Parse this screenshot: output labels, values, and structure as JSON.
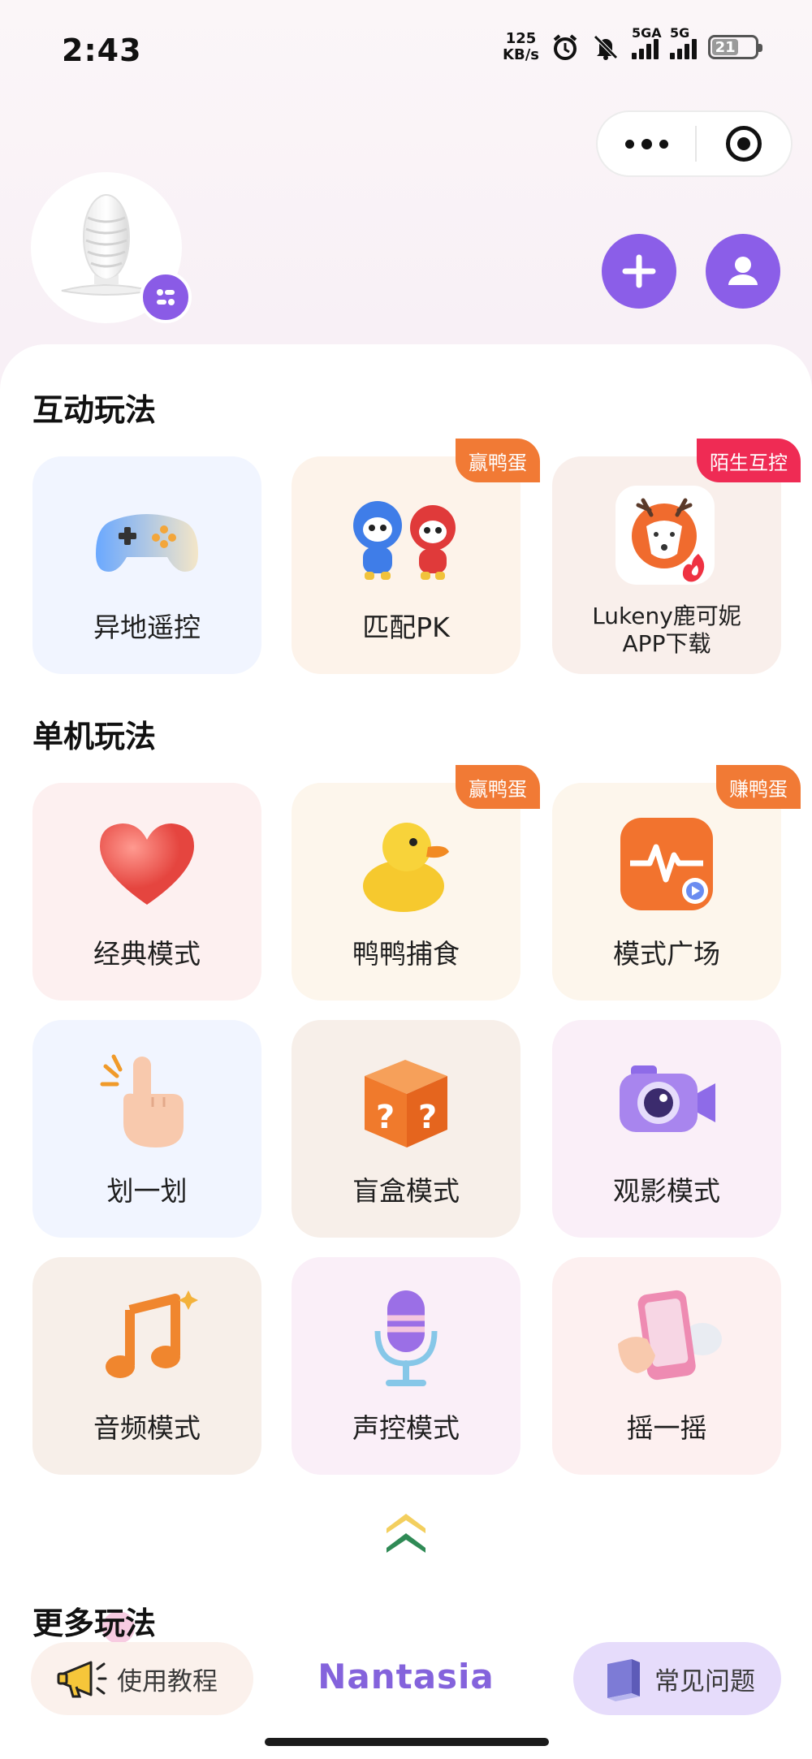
{
  "status_bar": {
    "time": "2:43",
    "net_speed_value": "125",
    "net_speed_unit": "KB/s",
    "sim1": "5GA",
    "sim2": "5G",
    "battery": "21"
  },
  "header": {
    "capsule_more_icon": "more-dots-icon",
    "capsule_close_icon": "target-icon",
    "add_icon": "plus-icon",
    "user_icon": "user-icon",
    "accent_color": "#8b5ee8"
  },
  "sections": {
    "interactive_title": "互动玩法",
    "solo_title": "单机玩法",
    "more_title": "更多玩法"
  },
  "interactive_cards": [
    {
      "label": "异地遥控",
      "badge": ""
    },
    {
      "label": "匹配PK",
      "badge": "赢鸭蛋"
    },
    {
      "label_line1": "Lukeny鹿可妮",
      "label_line2": "APP下载",
      "badge": "陌生互控"
    }
  ],
  "solo_cards": [
    {
      "label": "经典模式",
      "badge": ""
    },
    {
      "label": "鸭鸭捕食",
      "badge": "赢鸭蛋"
    },
    {
      "label": "模式广场",
      "badge": "赚鸭蛋"
    },
    {
      "label": "划一划",
      "badge": ""
    },
    {
      "label": "盲盒模式",
      "badge": ""
    },
    {
      "label": "观影模式",
      "badge": ""
    },
    {
      "label": "音频模式",
      "badge": ""
    },
    {
      "label": "声控模式",
      "badge": ""
    },
    {
      "label": "摇一摇",
      "badge": ""
    }
  ],
  "bottom": {
    "tutorial_label": "使用教程",
    "brand": "Nantasia",
    "faq_label": "常见问题"
  }
}
